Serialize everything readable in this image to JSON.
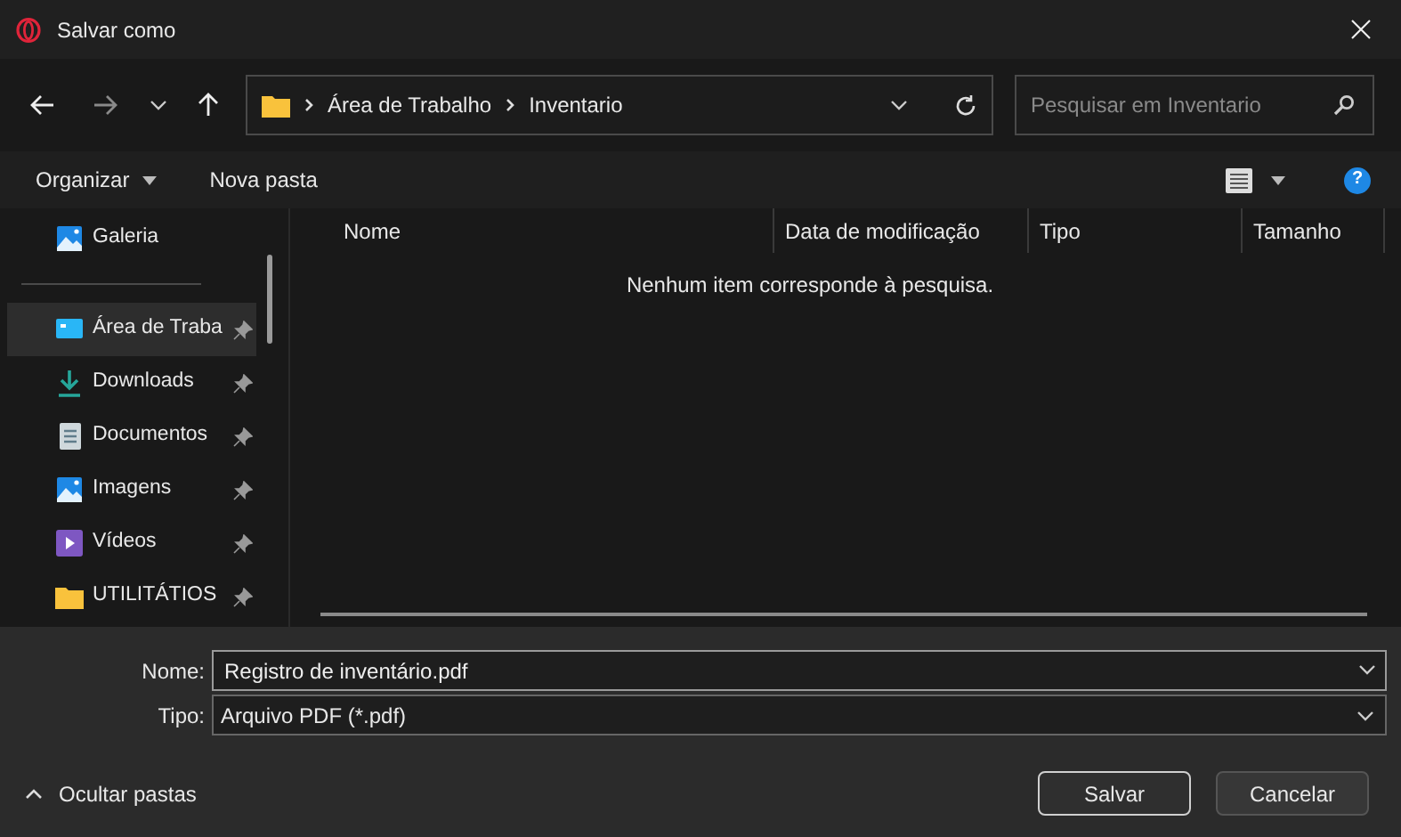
{
  "window": {
    "title": "Salvar como"
  },
  "address": {
    "crumbs": [
      "Área de Trabalho",
      "Inventario"
    ]
  },
  "search": {
    "placeholder": "Pesquisar em Inventario"
  },
  "toolbar": {
    "organize": "Organizar",
    "new_folder": "Nova pasta",
    "help": "?"
  },
  "sidebar": {
    "items": [
      {
        "label": "Galeria",
        "kind": "gallery",
        "pinned": false,
        "selected": false
      },
      {
        "label": "Área de Traba",
        "kind": "desktop",
        "pinned": true,
        "selected": true
      },
      {
        "label": "Downloads",
        "kind": "downloads",
        "pinned": true,
        "selected": false
      },
      {
        "label": "Documentos",
        "kind": "documents",
        "pinned": true,
        "selected": false
      },
      {
        "label": "Imagens",
        "kind": "pictures",
        "pinned": true,
        "selected": false
      },
      {
        "label": "Vídeos",
        "kind": "videos",
        "pinned": true,
        "selected": false
      },
      {
        "label": "UTILITÁTIOS",
        "kind": "folder",
        "pinned": true,
        "selected": false
      }
    ]
  },
  "table": {
    "columns": [
      "Nome",
      "Data de modificação",
      "Tipo",
      "Tamanho"
    ],
    "empty_message": "Nenhum item corresponde à pesquisa."
  },
  "form": {
    "name_label": "Nome:",
    "name_value": "Registro de inventário.pdf",
    "type_label": "Tipo:",
    "type_value": "Arquivo PDF (*.pdf)"
  },
  "footer": {
    "hide_folders": "Ocultar pastas",
    "save": "Salvar",
    "cancel": "Cancelar"
  }
}
